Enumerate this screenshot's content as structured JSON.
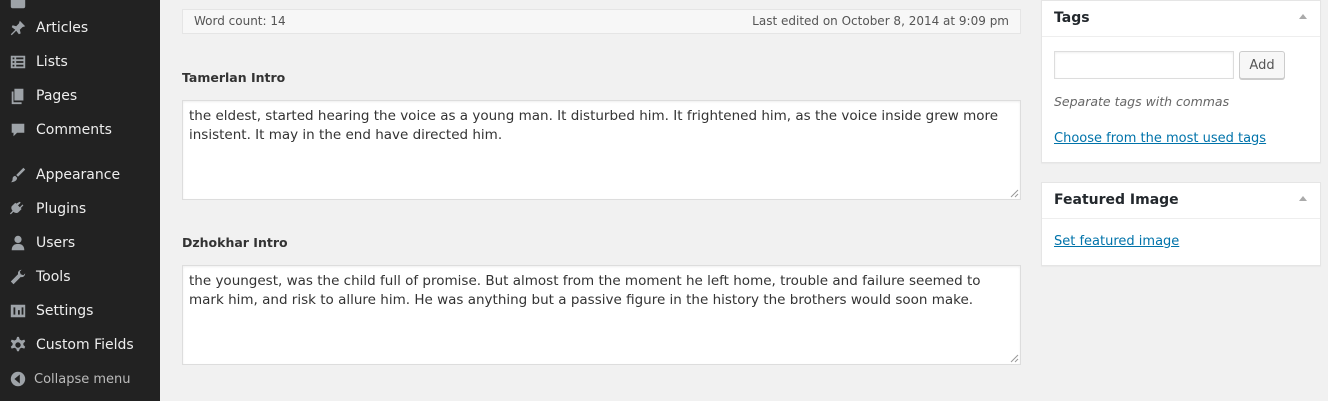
{
  "sidebar": {
    "items": [
      {
        "label": "Articles",
        "icon": "pin-icon"
      },
      {
        "label": "Lists",
        "icon": "list-icon"
      },
      {
        "label": "Pages",
        "icon": "pages-icon"
      },
      {
        "label": "Comments",
        "icon": "comment-icon"
      },
      {
        "label": "Appearance",
        "icon": "brush-icon"
      },
      {
        "label": "Plugins",
        "icon": "plug-icon"
      },
      {
        "label": "Users",
        "icon": "user-icon"
      },
      {
        "label": "Tools",
        "icon": "wrench-icon"
      },
      {
        "label": "Settings",
        "icon": "settings-icon"
      },
      {
        "label": "Custom Fields",
        "icon": "gear-icon"
      }
    ],
    "collapse_label": "Collapse menu"
  },
  "editor_status": {
    "word_count": "Word count: 14",
    "last_edited": "Last edited on October 8, 2014 at 9:09 pm"
  },
  "fields": [
    {
      "label": "Tamerlan Intro",
      "value": "the eldest, started hearing the voice as a young man. It disturbed him. It frightened him, as the voice inside grew more insistent. It may in the end have directed him."
    },
    {
      "label": "Dzhokhar Intro",
      "value": "the youngest, was the child full of promise. But almost from the moment he left home, trouble and failure seemed to mark him, and risk to allure him. He was anything but a passive figure in the history the brothers would soon make."
    }
  ],
  "tags_box": {
    "title": "Tags",
    "input_value": "",
    "add_label": "Add",
    "hint": "Separate tags with commas",
    "most_used_link": "Choose from the most used tags"
  },
  "featured_box": {
    "title": "Featured Image",
    "set_link": "Set featured image"
  },
  "colors": {
    "sidebar_bg": "#222222",
    "link": "#0073aa",
    "page_bg": "#f1f1f1"
  }
}
